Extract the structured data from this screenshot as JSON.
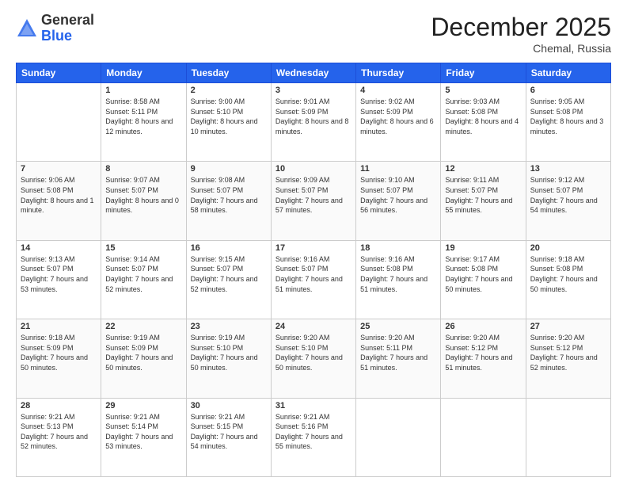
{
  "header": {
    "logo": {
      "line1": "General",
      "line2": "Blue"
    },
    "title": "December 2025",
    "location": "Chemal, Russia"
  },
  "weekdays": [
    "Sunday",
    "Monday",
    "Tuesday",
    "Wednesday",
    "Thursday",
    "Friday",
    "Saturday"
  ],
  "weeks": [
    [
      {
        "day": "",
        "sunrise": "",
        "sunset": "",
        "daylight": "",
        "empty": true
      },
      {
        "day": "1",
        "sunrise": "Sunrise: 8:58 AM",
        "sunset": "Sunset: 5:11 PM",
        "daylight": "Daylight: 8 hours and 12 minutes."
      },
      {
        "day": "2",
        "sunrise": "Sunrise: 9:00 AM",
        "sunset": "Sunset: 5:10 PM",
        "daylight": "Daylight: 8 hours and 10 minutes."
      },
      {
        "day": "3",
        "sunrise": "Sunrise: 9:01 AM",
        "sunset": "Sunset: 5:09 PM",
        "daylight": "Daylight: 8 hours and 8 minutes."
      },
      {
        "day": "4",
        "sunrise": "Sunrise: 9:02 AM",
        "sunset": "Sunset: 5:09 PM",
        "daylight": "Daylight: 8 hours and 6 minutes."
      },
      {
        "day": "5",
        "sunrise": "Sunrise: 9:03 AM",
        "sunset": "Sunset: 5:08 PM",
        "daylight": "Daylight: 8 hours and 4 minutes."
      },
      {
        "day": "6",
        "sunrise": "Sunrise: 9:05 AM",
        "sunset": "Sunset: 5:08 PM",
        "daylight": "Daylight: 8 hours and 3 minutes."
      }
    ],
    [
      {
        "day": "7",
        "sunrise": "Sunrise: 9:06 AM",
        "sunset": "Sunset: 5:08 PM",
        "daylight": "Daylight: 8 hours and 1 minute."
      },
      {
        "day": "8",
        "sunrise": "Sunrise: 9:07 AM",
        "sunset": "Sunset: 5:07 PM",
        "daylight": "Daylight: 8 hours and 0 minutes."
      },
      {
        "day": "9",
        "sunrise": "Sunrise: 9:08 AM",
        "sunset": "Sunset: 5:07 PM",
        "daylight": "Daylight: 7 hours and 58 minutes."
      },
      {
        "day": "10",
        "sunrise": "Sunrise: 9:09 AM",
        "sunset": "Sunset: 5:07 PM",
        "daylight": "Daylight: 7 hours and 57 minutes."
      },
      {
        "day": "11",
        "sunrise": "Sunrise: 9:10 AM",
        "sunset": "Sunset: 5:07 PM",
        "daylight": "Daylight: 7 hours and 56 minutes."
      },
      {
        "day": "12",
        "sunrise": "Sunrise: 9:11 AM",
        "sunset": "Sunset: 5:07 PM",
        "daylight": "Daylight: 7 hours and 55 minutes."
      },
      {
        "day": "13",
        "sunrise": "Sunrise: 9:12 AM",
        "sunset": "Sunset: 5:07 PM",
        "daylight": "Daylight: 7 hours and 54 minutes."
      }
    ],
    [
      {
        "day": "14",
        "sunrise": "Sunrise: 9:13 AM",
        "sunset": "Sunset: 5:07 PM",
        "daylight": "Daylight: 7 hours and 53 minutes."
      },
      {
        "day": "15",
        "sunrise": "Sunrise: 9:14 AM",
        "sunset": "Sunset: 5:07 PM",
        "daylight": "Daylight: 7 hours and 52 minutes."
      },
      {
        "day": "16",
        "sunrise": "Sunrise: 9:15 AM",
        "sunset": "Sunset: 5:07 PM",
        "daylight": "Daylight: 7 hours and 52 minutes."
      },
      {
        "day": "17",
        "sunrise": "Sunrise: 9:16 AM",
        "sunset": "Sunset: 5:07 PM",
        "daylight": "Daylight: 7 hours and 51 minutes."
      },
      {
        "day": "18",
        "sunrise": "Sunrise: 9:16 AM",
        "sunset": "Sunset: 5:08 PM",
        "daylight": "Daylight: 7 hours and 51 minutes."
      },
      {
        "day": "19",
        "sunrise": "Sunrise: 9:17 AM",
        "sunset": "Sunset: 5:08 PM",
        "daylight": "Daylight: 7 hours and 50 minutes."
      },
      {
        "day": "20",
        "sunrise": "Sunrise: 9:18 AM",
        "sunset": "Sunset: 5:08 PM",
        "daylight": "Daylight: 7 hours and 50 minutes."
      }
    ],
    [
      {
        "day": "21",
        "sunrise": "Sunrise: 9:18 AM",
        "sunset": "Sunset: 5:09 PM",
        "daylight": "Daylight: 7 hours and 50 minutes."
      },
      {
        "day": "22",
        "sunrise": "Sunrise: 9:19 AM",
        "sunset": "Sunset: 5:09 PM",
        "daylight": "Daylight: 7 hours and 50 minutes."
      },
      {
        "day": "23",
        "sunrise": "Sunrise: 9:19 AM",
        "sunset": "Sunset: 5:10 PM",
        "daylight": "Daylight: 7 hours and 50 minutes."
      },
      {
        "day": "24",
        "sunrise": "Sunrise: 9:20 AM",
        "sunset": "Sunset: 5:10 PM",
        "daylight": "Daylight: 7 hours and 50 minutes."
      },
      {
        "day": "25",
        "sunrise": "Sunrise: 9:20 AM",
        "sunset": "Sunset: 5:11 PM",
        "daylight": "Daylight: 7 hours and 51 minutes."
      },
      {
        "day": "26",
        "sunrise": "Sunrise: 9:20 AM",
        "sunset": "Sunset: 5:12 PM",
        "daylight": "Daylight: 7 hours and 51 minutes."
      },
      {
        "day": "27",
        "sunrise": "Sunrise: 9:20 AM",
        "sunset": "Sunset: 5:12 PM",
        "daylight": "Daylight: 7 hours and 52 minutes."
      }
    ],
    [
      {
        "day": "28",
        "sunrise": "Sunrise: 9:21 AM",
        "sunset": "Sunset: 5:13 PM",
        "daylight": "Daylight: 7 hours and 52 minutes."
      },
      {
        "day": "29",
        "sunrise": "Sunrise: 9:21 AM",
        "sunset": "Sunset: 5:14 PM",
        "daylight": "Daylight: 7 hours and 53 minutes."
      },
      {
        "day": "30",
        "sunrise": "Sunrise: 9:21 AM",
        "sunset": "Sunset: 5:15 PM",
        "daylight": "Daylight: 7 hours and 54 minutes."
      },
      {
        "day": "31",
        "sunrise": "Sunrise: 9:21 AM",
        "sunset": "Sunset: 5:16 PM",
        "daylight": "Daylight: 7 hours and 55 minutes."
      },
      {
        "day": "",
        "sunrise": "",
        "sunset": "",
        "daylight": "",
        "empty": true
      },
      {
        "day": "",
        "sunrise": "",
        "sunset": "",
        "daylight": "",
        "empty": true
      },
      {
        "day": "",
        "sunrise": "",
        "sunset": "",
        "daylight": "",
        "empty": true
      }
    ]
  ]
}
